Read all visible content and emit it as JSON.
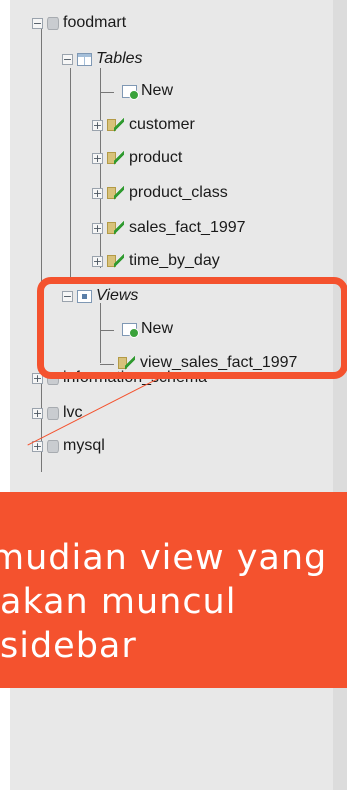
{
  "tree": {
    "database_foodmart": "foodmart",
    "tables_group": "Tables",
    "tables_new": "New",
    "tables": [
      "customer",
      "product",
      "product_class",
      "sales_fact_1997",
      "time_by_day"
    ],
    "views_group": "Views",
    "views_new": "New",
    "views": [
      "view_sales_fact_1997"
    ],
    "other_databases": [
      "information_schema",
      "lvc",
      "mysql"
    ]
  },
  "callout": {
    "line1": "mudian view yang",
    "line2": "akan muncul",
    "line3": "sidebar"
  },
  "colors": {
    "accent": "#f4522e",
    "panel": "#e8e8e8"
  }
}
